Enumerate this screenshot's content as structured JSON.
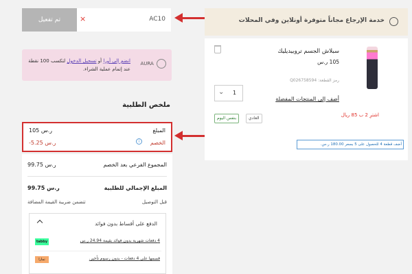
{
  "return_banner": {
    "text": "خدمة الإرجاع مجاناً متوفرة أونلاين وفي المحلات",
    "icon": "box-icon"
  },
  "product": {
    "title": "سبلاش الجسم تروبيديليك",
    "price": "105 ر.س",
    "sku": "رمز القطعة: Q026758594",
    "quantity": "1",
    "wishlist_link": "أضف إلى المنتجات المفضلة",
    "buy_line": "اشترِ 2 ب 85 ريال",
    "delivery_normal": "العادي",
    "delivery_same_day": "بنفس اليوم",
    "offer_banner": "أضف قطعة 4 للحصول على 5 بسعر 180.00 ر.س."
  },
  "promo": {
    "code_value": "AC10",
    "apply_label": "تم تفعيل",
    "clear_label": "×"
  },
  "aura": {
    "logo_label": "AURA",
    "join_link": "انضم إلى أورا",
    "or_text": "أو",
    "login_link": "تسجيل الدخول",
    "text_rest": "لتكسب 100 نقطة عند إتمام عملية الشراء."
  },
  "summary": {
    "title": "ملخص الطلبية",
    "amount_label": "المبلغ",
    "amount_value": "105 ر.س",
    "discount_label": "الخصم",
    "discount_value": "-5.25 ر.س",
    "subtotal_label": "المجموع الفرعي بعد الخصم",
    "subtotal_value": "99.75 ر.س",
    "total_label": "المبلغ الإجمالي للطلبية",
    "total_value": "99.75 ر.س",
    "vat_note": "تتضمن ضريبة القيمة المضافة",
    "delivery_label": "قبل التوصيل"
  },
  "installments": {
    "title": "الدفع على أقساط بدون فوائد",
    "tabby_logo": "tabby",
    "tabby_text": "4 دفعات شهرية بدون فوائد بقيمة 24.94 ر.س",
    "tamara_logo": "تمارا",
    "tamara_text": "قسمها على 4 دفعات - بدون رسوم تأخير."
  },
  "colors": {
    "annotation_red": "#d32f2f",
    "discount_red": "#c0392b",
    "banner_beige": "#f3ecdf",
    "aura_pink": "#f4dbe6"
  }
}
